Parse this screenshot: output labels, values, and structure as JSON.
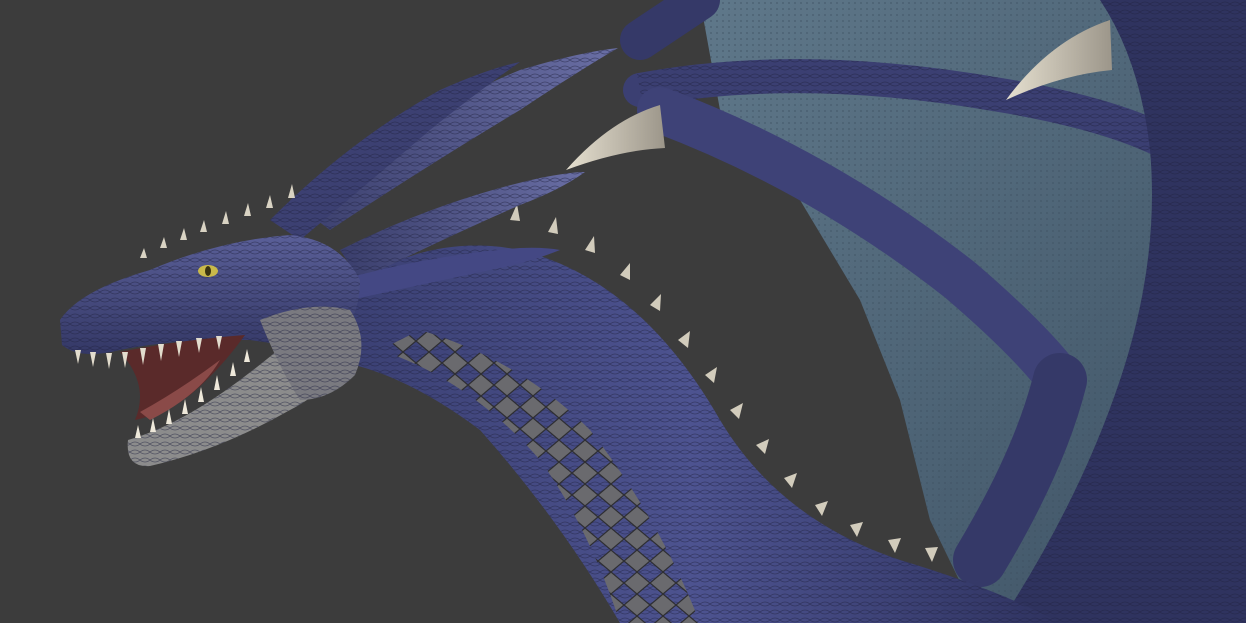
{
  "scene": {
    "subject": "dragon-render",
    "colors": {
      "background": "#3c3c3c",
      "skin_dark": "#2a2e52",
      "skin_mid": "#4a4f86",
      "skin_light": "#6d72a8",
      "wing_membrane": "#4f6678",
      "wing_membrane_light": "#6f8797",
      "jaw_grey": "#8c8c8c",
      "belly_grey": "#5e5e62",
      "spike_ivory": "#d9d3c3",
      "eye_yellow": "#c9b94a",
      "mouth_red": "#5a2a2a"
    }
  }
}
